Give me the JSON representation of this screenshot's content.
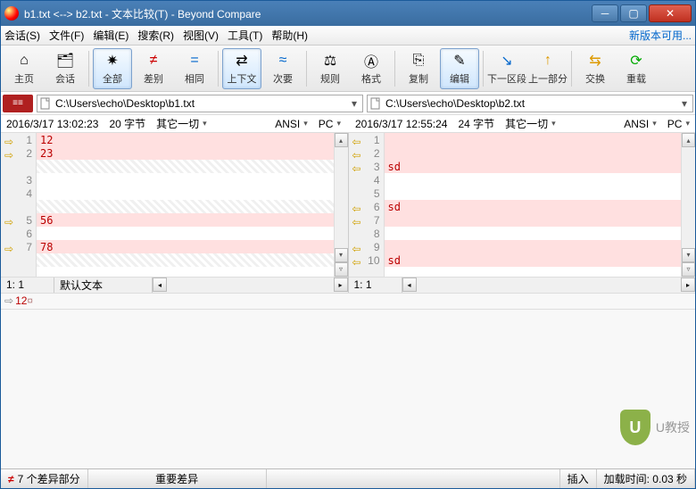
{
  "window": {
    "title": "b1.txt <--> b2.txt - 文本比较(T) - Beyond Compare"
  },
  "menu": {
    "session": "会话(S)",
    "file": "文件(F)",
    "edit": "编辑(E)",
    "search": "搜索(R)",
    "view": "视图(V)",
    "tools": "工具(T)",
    "help": "帮助(H)",
    "newversion": "新版本可用..."
  },
  "toolbar": {
    "home": "主页",
    "session": "会话",
    "all": "全部",
    "diff": "差别",
    "same": "相同",
    "context": "上下文",
    "minor": "次要",
    "rules": "规则",
    "format": "格式",
    "copy": "复制",
    "edit": "编辑",
    "nextsec": "下一区段",
    "prevsec": "上一部分",
    "swap": "交换",
    "reload": "重载"
  },
  "paths": {
    "left": "C:\\Users\\echo\\Desktop\\b1.txt",
    "right": "C:\\Users\\echo\\Desktop\\b2.txt"
  },
  "info": {
    "left": {
      "date": "2016/3/17 13:02:23",
      "size": "20 字节",
      "other": "其它一切",
      "enc": "ANSI",
      "plat": "PC"
    },
    "right": {
      "date": "2016/3/17 12:55:24",
      "size": "24 字节",
      "other": "其它一切",
      "enc": "ANSI",
      "plat": "PC"
    }
  },
  "left_lines": [
    {
      "n": 1,
      "t": "12",
      "cls": "diff",
      "arr": "yellow"
    },
    {
      "n": 2,
      "t": "23",
      "cls": "diff",
      "arr": "yellow"
    },
    {
      "n": "",
      "t": "",
      "cls": "hatch",
      "arr": ""
    },
    {
      "n": 3,
      "t": "",
      "cls": "",
      "arr": ""
    },
    {
      "n": 4,
      "t": "",
      "cls": "",
      "arr": ""
    },
    {
      "n": "",
      "t": "",
      "cls": "hatch",
      "arr": ""
    },
    {
      "n": 5,
      "t": "56",
      "cls": "diff",
      "arr": "yellow"
    },
    {
      "n": 6,
      "t": "",
      "cls": "",
      "arr": ""
    },
    {
      "n": 7,
      "t": "78",
      "cls": "diff",
      "arr": "yellow"
    },
    {
      "n": "",
      "t": "",
      "cls": "hatch",
      "arr": ""
    }
  ],
  "right_lines": [
    {
      "n": 1,
      "t": "",
      "cls": "diff",
      "arr": "back"
    },
    {
      "n": 2,
      "t": "",
      "cls": "diff",
      "arr": "back"
    },
    {
      "n": 3,
      "t": "sd",
      "cls": "diff",
      "arr": "back"
    },
    {
      "n": 4,
      "t": "",
      "cls": "",
      "arr": ""
    },
    {
      "n": 5,
      "t": "",
      "cls": "",
      "arr": ""
    },
    {
      "n": 6,
      "t": "sd",
      "cls": "diff",
      "arr": "back"
    },
    {
      "n": 7,
      "t": "",
      "cls": "diff",
      "arr": "back"
    },
    {
      "n": 8,
      "t": "",
      "cls": "",
      "arr": ""
    },
    {
      "n": 9,
      "t": "",
      "cls": "diff",
      "arr": "back"
    },
    {
      "n": 10,
      "t": "sd",
      "cls": "diff",
      "arr": "back"
    }
  ],
  "panebot": {
    "left_pos": "1: 1",
    "left_mode": "默认文本",
    "right_pos": "1: 1"
  },
  "editline": {
    "text": "12"
  },
  "status": {
    "diffs": "7 个差异部分",
    "major": "重要差异",
    "insert": "插入",
    "load": "加载时间: 0.03 秒"
  },
  "watermark": {
    "letter": "U",
    "text": "U教授"
  }
}
